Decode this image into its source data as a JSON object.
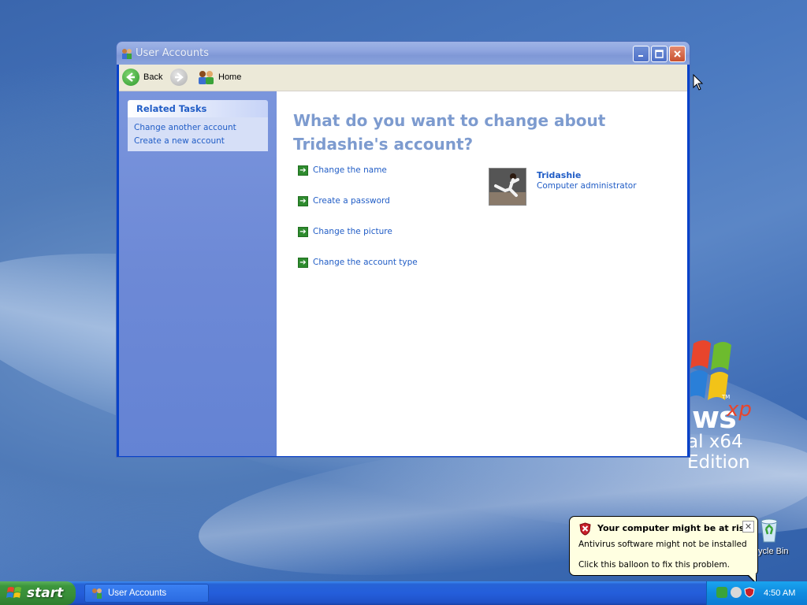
{
  "window": {
    "title": "User Accounts",
    "toolbar": {
      "back_label": "Back",
      "home_label": "Home"
    }
  },
  "left_pane": {
    "related_tasks_title": "Related Tasks",
    "tasks": [
      {
        "label": "Change another account"
      },
      {
        "label": "Create a new account"
      }
    ]
  },
  "main": {
    "heading": "What do you want to change about Tridashie's account?",
    "actions": [
      {
        "label": "Change the name"
      },
      {
        "label": "Create a password"
      },
      {
        "label": "Change the picture"
      },
      {
        "label": "Change the account type"
      }
    ],
    "user": {
      "name": "Tridashie",
      "role": "Computer administrator"
    }
  },
  "desktop": {
    "logo_text_ws": "ws",
    "logo_text_xp": "xp",
    "logo_tm": "TM",
    "edition_text": "al x64 Edition",
    "recycle_bin_label": "ycle Bin"
  },
  "balloon": {
    "title": "Your computer might be at risk",
    "line1": "Antivirus software might not be installed",
    "line2": "Click this balloon to fix this problem."
  },
  "taskbar": {
    "start_label": "start",
    "task_item_label": "User Accounts",
    "clock": "4:50 AM"
  },
  "colors": {
    "link_blue": "#215dc6",
    "heading_blue": "#7d9bcf",
    "balloon_bg": "#ffffe1",
    "taskbar_blue": "#245edb",
    "start_green": "#388e38"
  }
}
